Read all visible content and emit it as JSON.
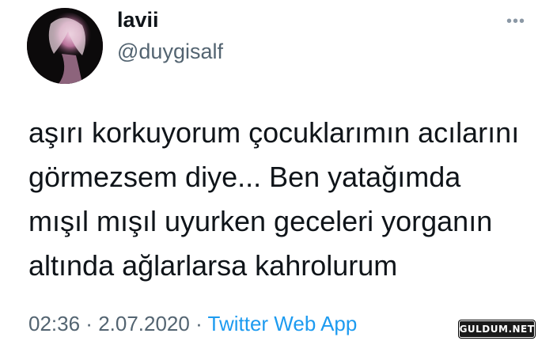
{
  "user": {
    "display_name": "lavii",
    "handle": "@duygisalf",
    "avatar_icon": "profile-photo"
  },
  "more_icon_glyph": "•••",
  "tweet": {
    "lines": [
      "aşırı korkuyorum çocuklarımın acılarını",
      "görmezsem diye... Ben yatağımda",
      "mışıl mışıl uyurken geceleri yorganın",
      "altında ağlarlarsa kahrolurum"
    ]
  },
  "meta": {
    "time": "02:36",
    "separator": " · ",
    "date": "2.07.2020",
    "source": "Twitter Web App"
  },
  "watermark": "GULDUM.NET",
  "colors": {
    "text": "#0f1419",
    "secondary": "#536471",
    "link": "#1d9bf0"
  }
}
